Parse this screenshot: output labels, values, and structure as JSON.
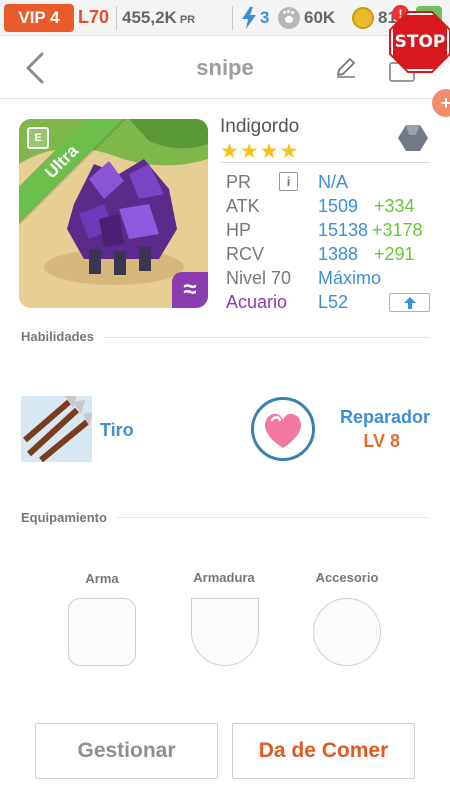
{
  "topbar": {
    "vip": "VIP 4",
    "level": "L70",
    "power": "455,2K",
    "power_unit": "PR",
    "energy": "3",
    "paw_count": "60K",
    "coins": "81",
    "alert": "!"
  },
  "overlay": {
    "stop_sign": "STOP"
  },
  "header": {
    "title": "snipe"
  },
  "creature": {
    "name": "Indigordo",
    "stars": 4,
    "stars_text": "★★★★",
    "rarity": "Ultra",
    "stats": [
      {
        "label": "PR",
        "value": "N/A",
        "bonus": ""
      },
      {
        "label": "ATK",
        "value": "1509",
        "bonus": "+334"
      },
      {
        "label": "HP",
        "value": "15138",
        "bonus": "+3178"
      },
      {
        "label": "RCV",
        "value": "1388",
        "bonus": "+291"
      },
      {
        "label": "Nivel 70",
        "value": "Máximo",
        "bonus": ""
      },
      {
        "label": "Acuario",
        "value": "L52",
        "bonus": ""
      }
    ]
  },
  "sections": {
    "abilities": "Habilidades",
    "equipment": "Equipamiento"
  },
  "ability": {
    "name": "Tiro"
  },
  "passive": {
    "name": "Reparador",
    "level": "LV 8"
  },
  "equipment": {
    "slots": [
      "Arma",
      "Armadura",
      "Accesorio"
    ]
  },
  "buttons": {
    "manage": "Gestionar",
    "feed": "Da de Comer"
  },
  "colors": {
    "accent_blue": "#3b8fd9",
    "bonus_green": "#6cc33a",
    "orange": "#e0702a",
    "purple": "#8a3cb0",
    "rarity_green": "#6bbf4a",
    "vip_orange": "#ea5a2b"
  }
}
